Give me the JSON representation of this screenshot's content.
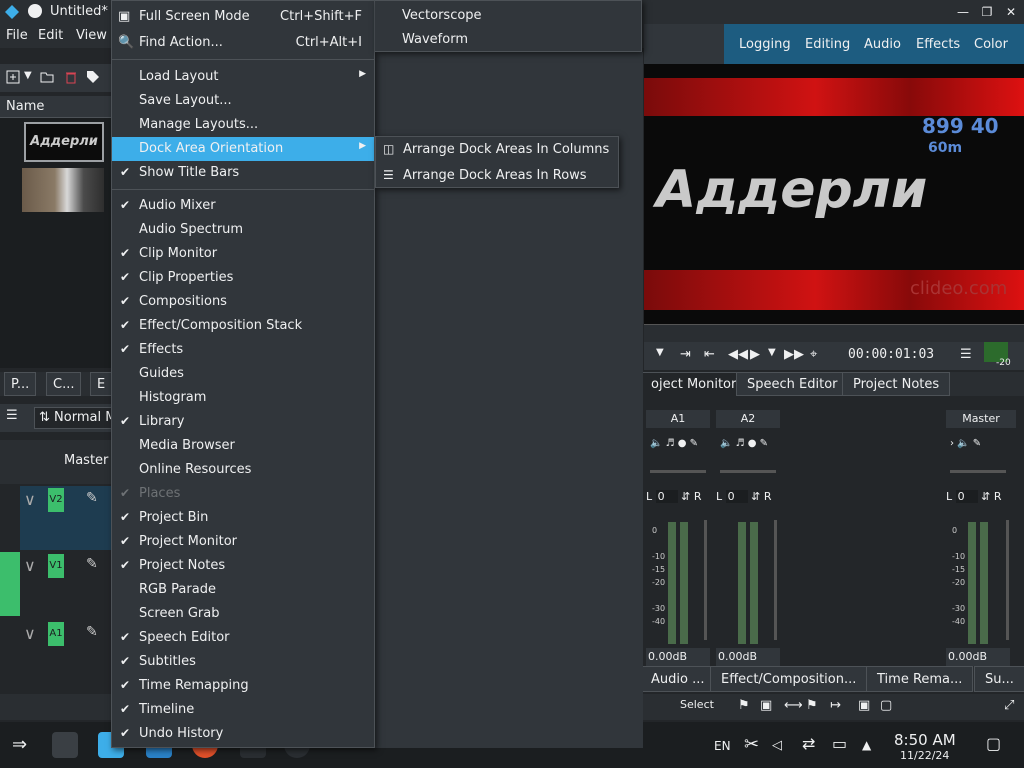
{
  "window": {
    "title": "Untitled* ",
    "menus": [
      "File",
      "Edit",
      "View"
    ]
  },
  "workspaces": [
    "Logging",
    "Editing",
    "Audio",
    "Effects",
    "Color"
  ],
  "project_bin": {
    "column_name": "Name",
    "thumb_text": "Аддерли",
    "tabs": [
      "P...",
      "C...",
      "E"
    ]
  },
  "timeline": {
    "mode": "Normal M",
    "master_label": "Master",
    "tracks": [
      "V2",
      "V1",
      "A1"
    ]
  },
  "monitor": {
    "overlay_text": "Аддерли",
    "number_text": "899  40",
    "small_text": "60m",
    "watermark": "clideo.com",
    "timecode": "00:00:01:03",
    "tabs": [
      "oject Monitor",
      "Speech Editor",
      "Project Notes"
    ]
  },
  "mixer": {
    "channels": [
      {
        "name": "A1",
        "pan": "0",
        "db": "0.00dB"
      },
      {
        "name": "A2",
        "pan": "0",
        "db": "0.00dB"
      },
      {
        "name": "Master",
        "pan": "0",
        "db": "0.00dB"
      }
    ],
    "scale": [
      "0",
      "-10",
      "-15",
      "-20",
      "-30",
      "-40"
    ],
    "l": "L",
    "r": "R"
  },
  "bottom_tabs": [
    "Audio ...",
    "Effect/Composition...",
    "Time Rema...",
    "Su..."
  ],
  "status": {
    "select": "Select",
    "meter_low": "-20"
  },
  "main_menu": {
    "top_items": [
      {
        "label": "Full Screen Mode",
        "shortcut": "Ctrl+Shift+F",
        "icon": "fullscreen-icon"
      },
      {
        "label": "Find Action...",
        "shortcut": "Ctrl+Alt+I",
        "icon": "search-icon"
      }
    ],
    "layout_items": [
      {
        "label": "Load Layout",
        "submenu": true
      },
      {
        "label": "Save Layout..."
      },
      {
        "label": "Manage Layouts..."
      },
      {
        "label": "Dock Area Orientation",
        "submenu": true,
        "highlighted": true
      },
      {
        "label": "Show Title Bars",
        "checked": true
      }
    ],
    "dock_items": [
      {
        "label": "Audio Mixer",
        "checked": true
      },
      {
        "label": "Audio Spectrum",
        "checked": false
      },
      {
        "label": "Clip Monitor",
        "checked": true
      },
      {
        "label": "Clip Properties",
        "checked": true
      },
      {
        "label": "Compositions",
        "checked": true
      },
      {
        "label": "Effect/Composition Stack",
        "checked": true
      },
      {
        "label": "Effects",
        "checked": true
      },
      {
        "label": "Guides",
        "checked": false
      },
      {
        "label": "Histogram",
        "checked": false
      },
      {
        "label": "Library",
        "checked": true
      },
      {
        "label": "Media Browser",
        "checked": false
      },
      {
        "label": "Online Resources",
        "checked": false
      },
      {
        "label": "Places",
        "checked": true,
        "disabled": true
      },
      {
        "label": "Project Bin",
        "checked": true
      },
      {
        "label": "Project Monitor",
        "checked": true
      },
      {
        "label": "Project Notes",
        "checked": true
      },
      {
        "label": "RGB Parade",
        "checked": false
      },
      {
        "label": "Screen Grab",
        "checked": false
      },
      {
        "label": "Speech Editor",
        "checked": true
      },
      {
        "label": "Subtitles",
        "checked": true
      },
      {
        "label": "Time Remapping",
        "checked": true
      },
      {
        "label": "Timeline",
        "checked": true
      },
      {
        "label": "Undo History",
        "checked": true
      }
    ]
  },
  "scopes_submenu": [
    "Vectorscope",
    "Waveform"
  ],
  "orientation_submenu": [
    {
      "label": "Arrange Dock Areas In Columns",
      "icon": "columns-icon"
    },
    {
      "label": "Arrange Dock Areas In Rows",
      "icon": "rows-icon"
    }
  ],
  "taskbar": {
    "lang": "EN",
    "time": "8:50 AM",
    "date": "11/22/24"
  }
}
